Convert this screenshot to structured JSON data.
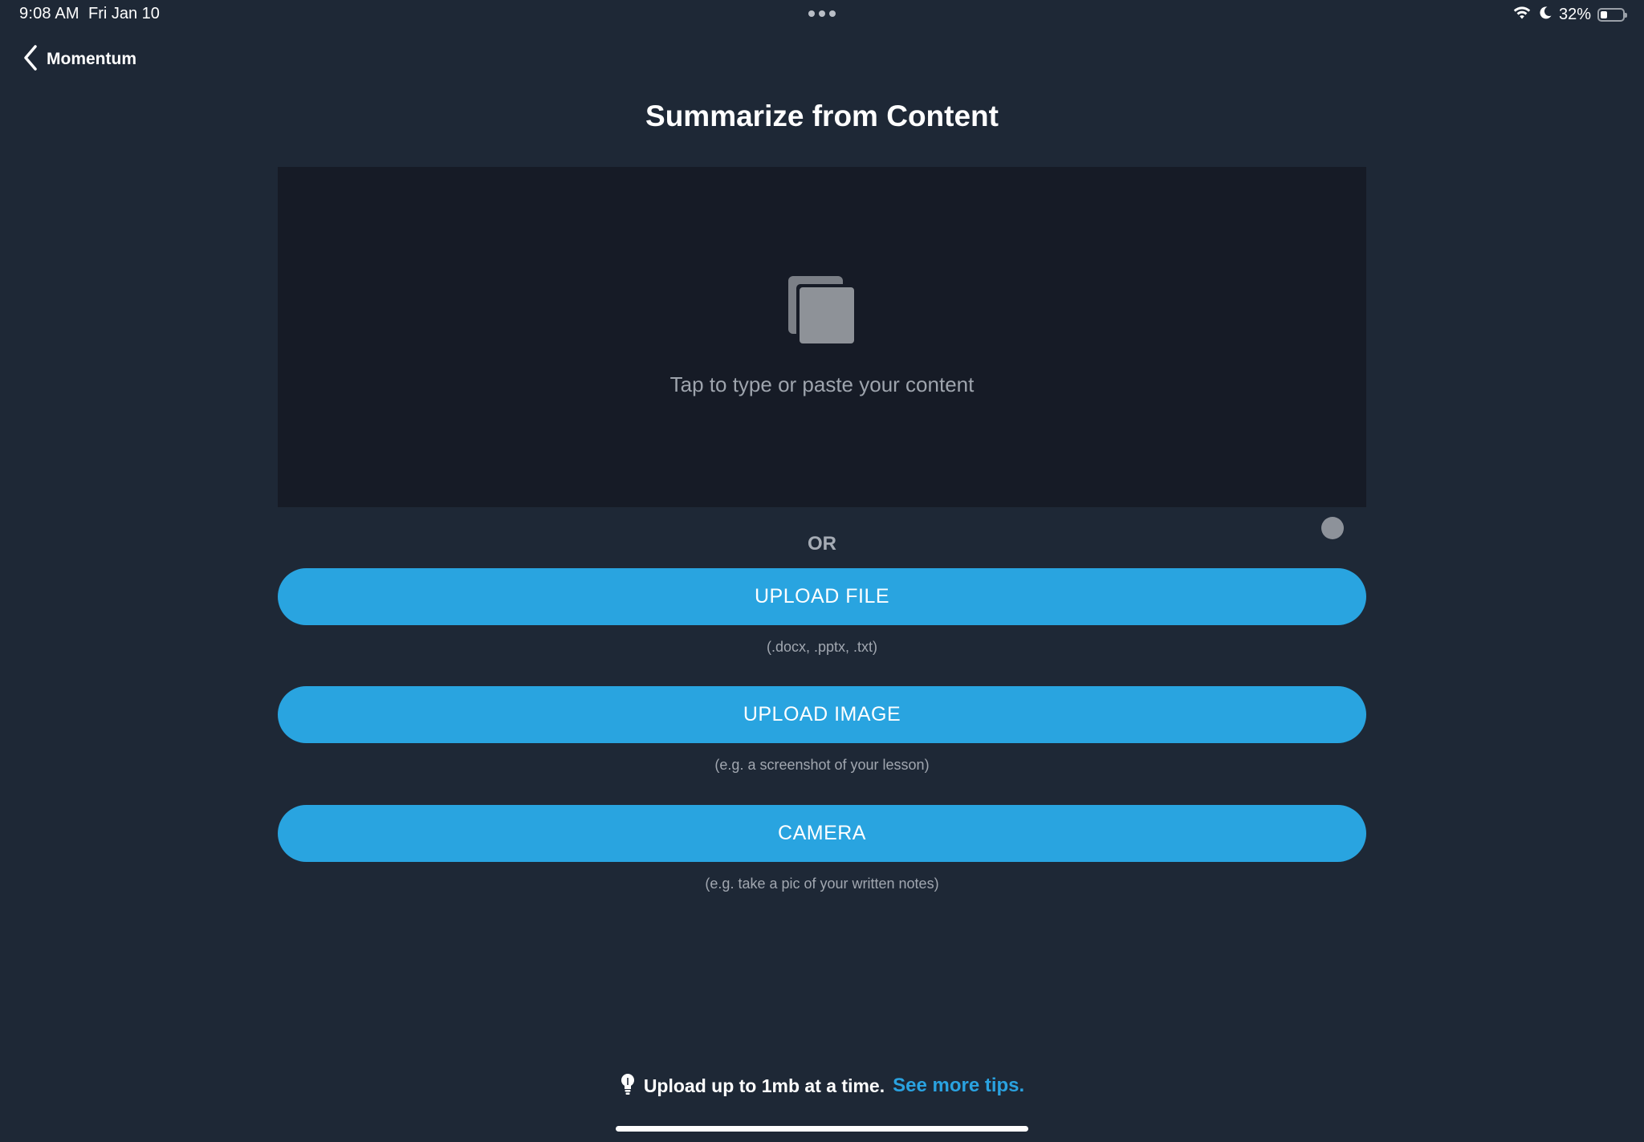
{
  "status_bar": {
    "time": "9:08 AM",
    "date": "Fri Jan 10",
    "battery_percent": "32%",
    "battery_level": 0.32,
    "icons": [
      "wifi-icon",
      "moon-icon",
      "battery-icon"
    ]
  },
  "nav": {
    "back_label": "Momentum"
  },
  "page": {
    "title": "Summarize from Content"
  },
  "content_input": {
    "placeholder": "Tap to type or paste your content",
    "icon": "paste-icon"
  },
  "or_label": "OR",
  "actions": {
    "upload_file": {
      "label": "UPLOAD FILE",
      "hint": "(.docx, .pptx, .txt)"
    },
    "upload_image": {
      "label": "UPLOAD IMAGE",
      "hint": "(e.g. a screenshot of your lesson)"
    },
    "camera": {
      "label": "CAMERA",
      "hint": "(e.g. take a pic of your written notes)"
    }
  },
  "tip": {
    "text": "Upload up to 1mb at a time.",
    "link": "See more tips.",
    "icon": "lightbulb-icon"
  },
  "colors": {
    "background": "#1e2836",
    "input_background": "#161b26",
    "accent": "#29a4e0",
    "muted_text": "#a1a7b0"
  }
}
